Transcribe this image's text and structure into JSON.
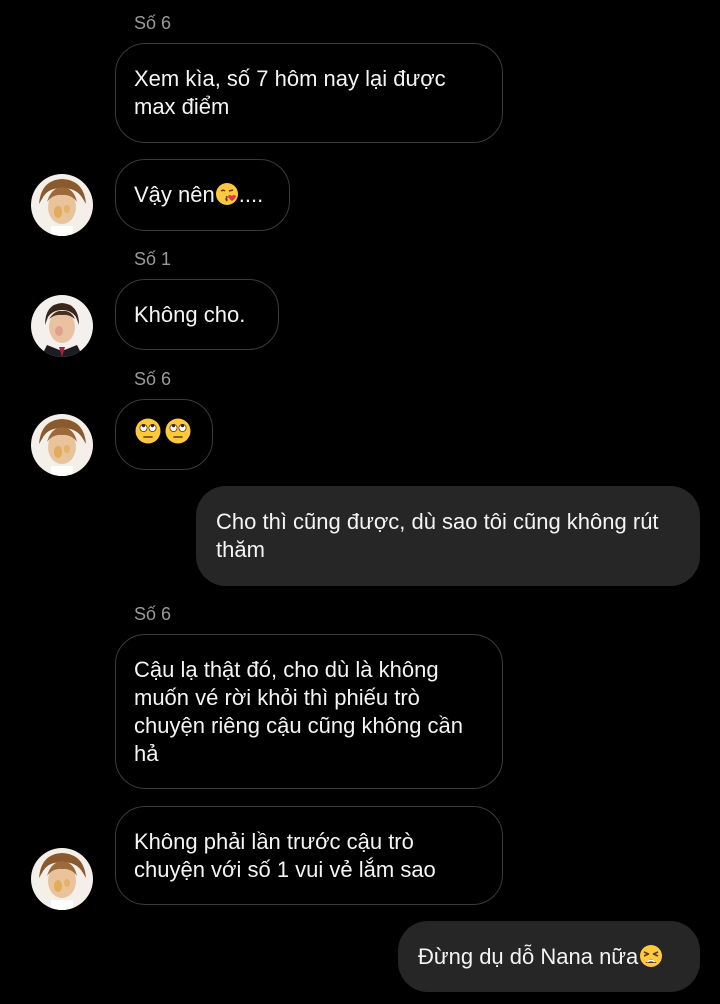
{
  "messages": [
    {
      "id": "m1",
      "sender": "Số 6",
      "text": "Xem kìa, số 7 hôm nay lại được max điểm"
    },
    {
      "id": "m2",
      "text": "Vậy nên",
      "suffix": "....",
      "emoji": "face-blowing-kiss-icon"
    },
    {
      "id": "m3",
      "sender": "Số 1",
      "text": " Không cho."
    },
    {
      "id": "m4",
      "sender": "Số 6",
      "emoji": "face-with-rolling-eyes-icon"
    },
    {
      "id": "m5",
      "direction": "outgoing",
      "text": "Cho thì cũng được, dù sao tôi cũng không rút thăm"
    },
    {
      "id": "m6",
      "sender": "Số 6",
      "text": "Cậu lạ thật đó, cho dù là không muốn vé rời khỏi thì phiếu trò chuyện riêng cậu cũng không cần hả"
    },
    {
      "id": "m7",
      "text": "Không phải lần trước cậu trò chuyện với số 1 vui vẻ lắm sao"
    },
    {
      "id": "m8",
      "direction": "outgoing",
      "text": "Đừng dụ dỗ Nana nữa",
      "emoji": "tired-face-icon"
    }
  ],
  "colors": {
    "background": "#000000",
    "incoming_border": "#3a3a3a",
    "outgoing_bubble": "#262626",
    "text": "#f4f4f4",
    "sender_label": "#9a9a9a"
  }
}
